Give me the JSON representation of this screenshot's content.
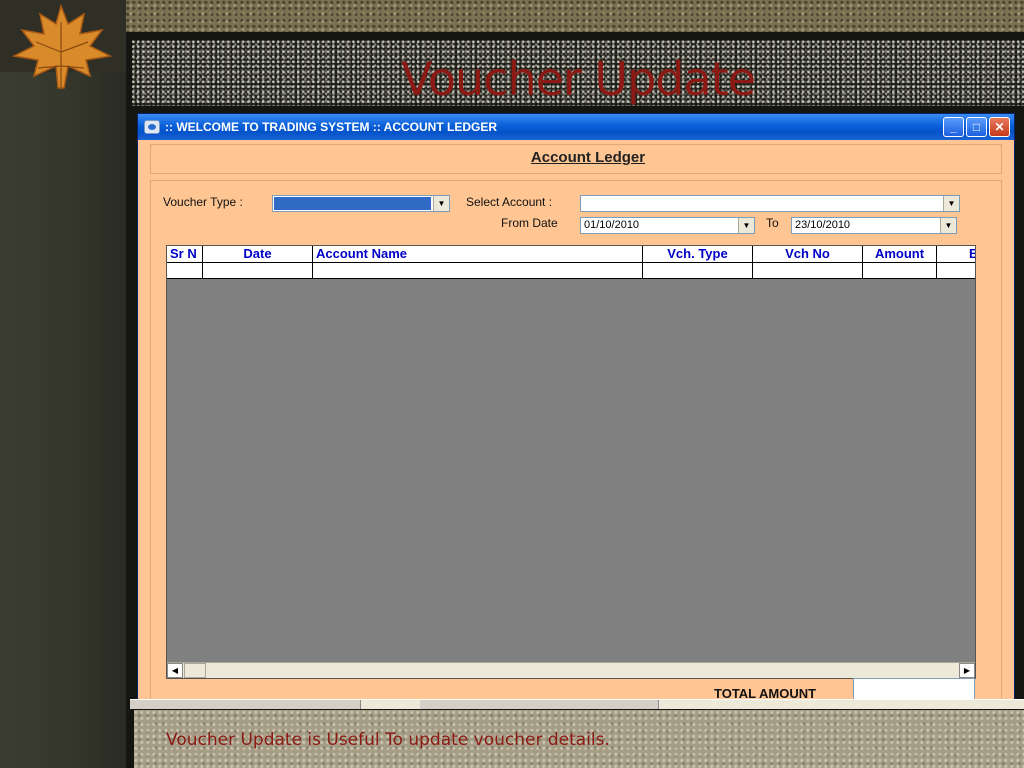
{
  "slide": {
    "title": "Voucher Update",
    "footer": "Voucher Update is Useful To update voucher details."
  },
  "window": {
    "title": ":: WELCOME TO TRADING SYSTEM :: ACCOUNT LEDGER",
    "controls": {
      "minimize": "_",
      "maximize": "□",
      "close": "✕"
    }
  },
  "form": {
    "header": "Account Ledger",
    "voucher_type_label": "Voucher Type :",
    "voucher_type_value": "",
    "select_account_label": "Select Account :",
    "select_account_value": "",
    "from_date_label": "From Date",
    "from_date_value": "01/10/2010",
    "to_label": "To",
    "to_date_value": "23/10/2010",
    "total_label": "TOTAL AMOUNT",
    "total_value": ""
  },
  "grid": {
    "columns": [
      "Sr N",
      "Date",
      "Account Name",
      "Vch. Type",
      "Vch No",
      "Amount",
      "B"
    ]
  },
  "colors": {
    "form_background": "#ffc693",
    "title_text": "#8b1a14",
    "grid_header_text": "#0000c8",
    "grid_empty_area": "#808080"
  },
  "icons": {
    "dropdown": "chevron-down-icon",
    "scroll_left": "scroll-left-icon",
    "scroll_right": "scroll-right-icon",
    "app": "trading-system-app-icon"
  }
}
